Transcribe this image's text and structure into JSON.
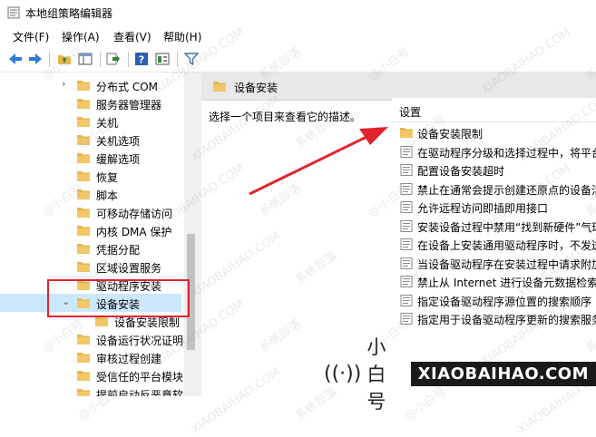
{
  "window": {
    "title": "本地组策略编辑器"
  },
  "menu": [
    "文件(F)",
    "操作(A)",
    "查看(V)",
    "帮助(H)"
  ],
  "tree": [
    {
      "label": "分布式 COM",
      "chevron": "›"
    },
    {
      "label": "服务器管理器"
    },
    {
      "label": "关机"
    },
    {
      "label": "关机选项"
    },
    {
      "label": "缓解选项"
    },
    {
      "label": "恢复"
    },
    {
      "label": "脚本"
    },
    {
      "label": "可移动存储访问"
    },
    {
      "label": "内核 DMA 保护"
    },
    {
      "label": "凭据分配"
    },
    {
      "label": "区域设置服务"
    },
    {
      "label": "驱动程序安装"
    },
    {
      "label": "设备安装",
      "chevron": "⌄"
    },
    {
      "label": "设备安装限制"
    },
    {
      "label": "设备运行状况证明"
    },
    {
      "label": "审核过程创建"
    },
    {
      "label": "受信任的平台模块"
    },
    {
      "label": "提前启动反恶意软"
    }
  ],
  "details": {
    "header_title": "设备安装",
    "description": "选择一个项目来查看它的描述。",
    "column_header": "设置",
    "items": [
      {
        "label": "设备安装限制",
        "icon": "folder"
      },
      {
        "label": "在驱动程序分级和选择过程中，将平台",
        "icon": "setting"
      },
      {
        "label": "配置设备安装超时",
        "icon": "setting"
      },
      {
        "label": "禁止在通常会提示创建还原点的设备活",
        "icon": "setting"
      },
      {
        "label": "允许远程访问即插即用接口",
        "icon": "setting"
      },
      {
        "label": "安装设备过程中禁用“找到新硬件”气球",
        "icon": "setting"
      },
      {
        "label": "在设备上安装通用驱动程序时，不发送",
        "icon": "setting"
      },
      {
        "label": "当设备驱动程序在安装过程中请求附加",
        "icon": "setting"
      },
      {
        "label": "禁止从 Internet 进行设备元数据检索",
        "icon": "setting"
      },
      {
        "label": "指定设备驱动程序源位置的搜索顺序",
        "icon": "setting"
      },
      {
        "label": "指定用于设备驱动程序更新的搜索服务",
        "icon": "setting"
      }
    ]
  },
  "watermark": {
    "brand_name": "小白号",
    "url": "XIAOBAIHAO.COM",
    "tile_a": "@小白号",
    "tile_b": "XIAOBAIHAO.COM",
    "tile_c": "系统部落",
    "logo_glyph": "((·))"
  },
  "colors": {
    "folder": "#e8b64c",
    "annotation": "#e0242e",
    "selection": "#cce8ff"
  }
}
